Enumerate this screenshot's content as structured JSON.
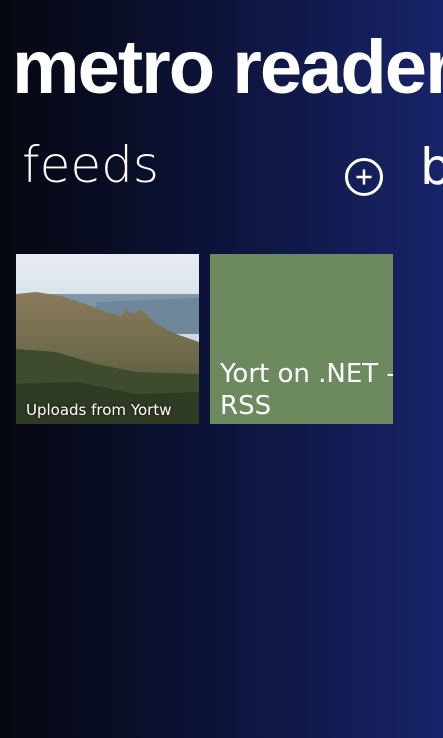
{
  "app": {
    "title": "metro reader"
  },
  "header": {
    "section_title": "feeds",
    "next_section_peek": "b"
  },
  "actions": {
    "add_icon": "plus-circle-icon"
  },
  "feeds": [
    {
      "label": "Uploads from Yortw",
      "type": "photo"
    },
    {
      "label": "Yort on .NET - RSS",
      "type": "text",
      "color": "#6d8a5e"
    }
  ]
}
